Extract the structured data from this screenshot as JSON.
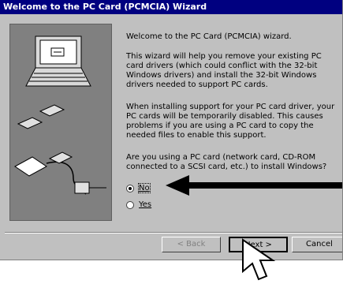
{
  "window": {
    "title": "Welcome to the PC Card (PCMCIA) Wizard"
  },
  "content": {
    "intro": "Welcome to the PC Card (PCMCIA) wizard.",
    "paragraph2": "This wizard will help you remove your existing PC card drivers (which could conflict with the 32-bit Windows drivers) and install the 32-bit Windows drivers needed to support PC cards.",
    "paragraph3": "When installing support for your PC card driver, your PC cards will be temporarily disabled. This causes problems if you are using a PC card to copy the needed files to enable this support.",
    "question": "Are you using a PC card (network card, CD-ROM connected to a SCSI card, etc.) to install Windows?"
  },
  "options": [
    {
      "label": "No",
      "selected": true
    },
    {
      "label": "Yes",
      "selected": false
    }
  ],
  "buttons": {
    "back": "< Back",
    "next": "Next >",
    "cancel": "Cancel"
  },
  "icons": {
    "arrow": "arrow-left-icon",
    "cursor": "mouse-pointer-icon"
  }
}
